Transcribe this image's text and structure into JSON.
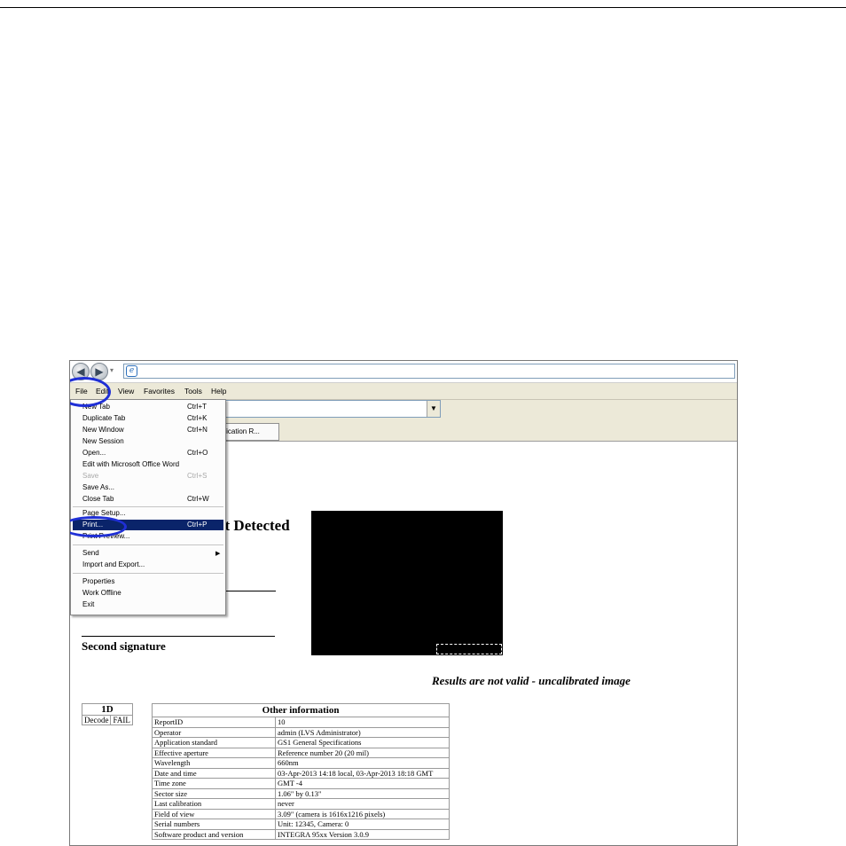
{
  "browser": {
    "back_glyph": "◀",
    "forward_glyph": "▶",
    "address_icon": "e",
    "menu": [
      "File",
      "Edit",
      "View",
      "Favorites",
      "Tools",
      "Help"
    ],
    "tab_title": "erification R...",
    "combo_arrow": "▼"
  },
  "file_menu": {
    "items": [
      {
        "label": "New Tab",
        "shortcut": "Ctrl+T"
      },
      {
        "label": "Duplicate Tab",
        "shortcut": "Ctrl+K"
      },
      {
        "label": "New Window",
        "shortcut": "Ctrl+N"
      },
      {
        "label": "New Session",
        "shortcut": ""
      },
      {
        "label": "Open...",
        "shortcut": "Ctrl+O"
      },
      {
        "label": "Edit with Microsoft Office Word",
        "shortcut": ""
      },
      {
        "label": "Save",
        "shortcut": "Ctrl+S"
      },
      {
        "label": "Save As...",
        "shortcut": ""
      },
      {
        "label": "Close Tab",
        "shortcut": "Ctrl+W"
      },
      {
        "label": "Page Setup...",
        "shortcut": ""
      },
      {
        "label": "Print...",
        "shortcut": "Ctrl+P"
      },
      {
        "label": "Print Preview...",
        "shortcut": ""
      },
      {
        "label": "Send",
        "shortcut": ""
      },
      {
        "label": "Import and Export...",
        "shortcut": ""
      },
      {
        "label": "Properties",
        "shortcut": ""
      },
      {
        "label": "Work Offline",
        "shortcut": ""
      },
      {
        "label": "Exit",
        "shortcut": ""
      }
    ],
    "submenu_arrow": "▶"
  },
  "page": {
    "heading": "ot Detected",
    "second_signature": "Second signature",
    "invalid_note": "Results are not valid - uncalibrated image"
  },
  "table_1d": {
    "header": "1D",
    "cell_label": "Decode",
    "cell_value": "FAIL"
  },
  "other_info": {
    "header": "Other information",
    "rows": [
      [
        "ReportID",
        "10"
      ],
      [
        "Operator",
        "admin (LVS Administrator)"
      ],
      [
        "Application standard",
        "GS1 General Specifications"
      ],
      [
        "Effective aperture",
        "Reference number 20 (20 mil)"
      ],
      [
        "Wavelength",
        "660nm"
      ],
      [
        "Date and time",
        "03-Apr-2013 14:18 local, 03-Apr-2013 18:18 GMT"
      ],
      [
        "Time zone",
        "GMT -4"
      ],
      [
        "Sector size",
        "1.06\" by 0.13\""
      ],
      [
        "Last calibration",
        "never"
      ],
      [
        "Field of view",
        "3.09\" (camera is 1616x1216 pixels)"
      ],
      [
        "Serial numbers",
        "Unit: 12345, Camera: 0"
      ],
      [
        "Software product and version",
        "INTEGRA 95xx Version 3.0.9"
      ]
    ]
  }
}
